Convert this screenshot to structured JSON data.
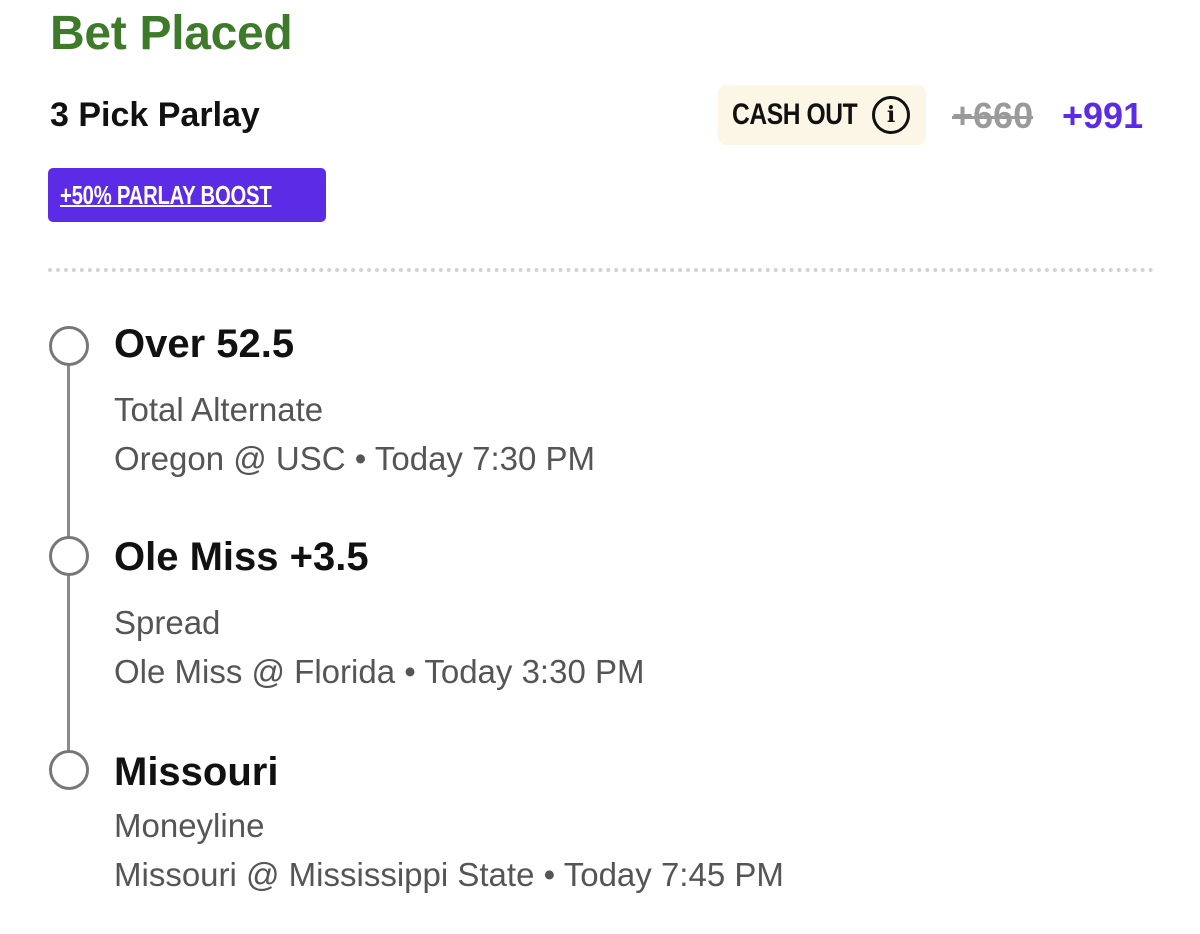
{
  "bet": {
    "status": "Bet Placed",
    "title": "3 Pick Parlay",
    "cash_out_label": "CASH OUT",
    "info_glyph": "i",
    "odds_original": "+660",
    "odds_boosted": "+991",
    "boost_label": "+50% PARLAY BOOST"
  },
  "picks": [
    {
      "selection": "Over 52.5",
      "market": "Total Alternate",
      "game": "Oregon @ USC • Today 7:30 PM"
    },
    {
      "selection": "Ole Miss +3.5",
      "market": "Spread",
      "game": "Ole Miss @ Florida • Today 3:30 PM"
    },
    {
      "selection": "Missouri",
      "market": "Moneyline",
      "game": "Missouri @ Mississippi State • Today 7:45 PM"
    }
  ],
  "colors": {
    "status_green": "#3d7a2a",
    "accent_purple": "#5b2be6",
    "cashout_bg": "#fbf6e6",
    "muted_text": "#555555",
    "strike_gray": "#9a9a9a"
  },
  "icons": [
    "info-circle-icon",
    "timeline-node-icon"
  ]
}
